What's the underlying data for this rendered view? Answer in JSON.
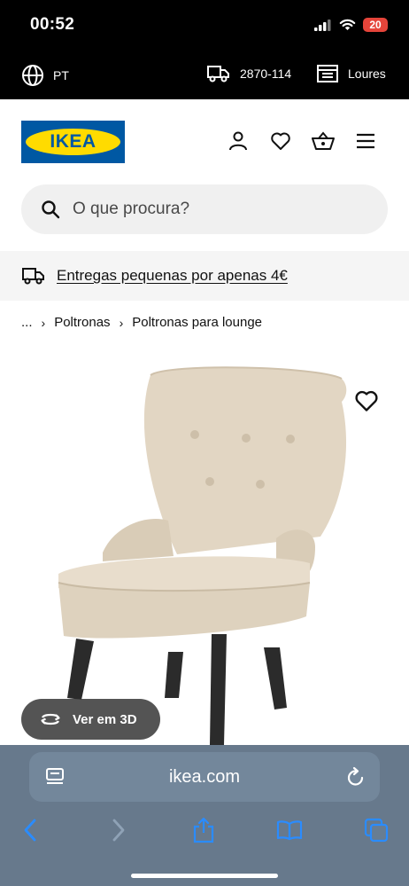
{
  "status_bar": {
    "time": "00:52",
    "battery": "20"
  },
  "utility_bar": {
    "language": "PT",
    "postal_code": "2870-114",
    "store": "Loures"
  },
  "header": {
    "logo_text": "IKEA"
  },
  "search": {
    "placeholder": "O que procura?"
  },
  "banner": {
    "text": "Entregas pequenas por apenas 4€"
  },
  "breadcrumb": {
    "ellipsis": "...",
    "items": [
      "Poltronas",
      "Poltronas para lounge"
    ]
  },
  "product": {
    "view_3d_label": "Ver em 3D"
  },
  "browser": {
    "url": "ikea.com"
  },
  "colors": {
    "ikea_blue": "#0058a3",
    "ikea_yellow": "#ffdb00",
    "battery_red": "#e5443a",
    "fabric_beige": "#e2d6c3"
  }
}
